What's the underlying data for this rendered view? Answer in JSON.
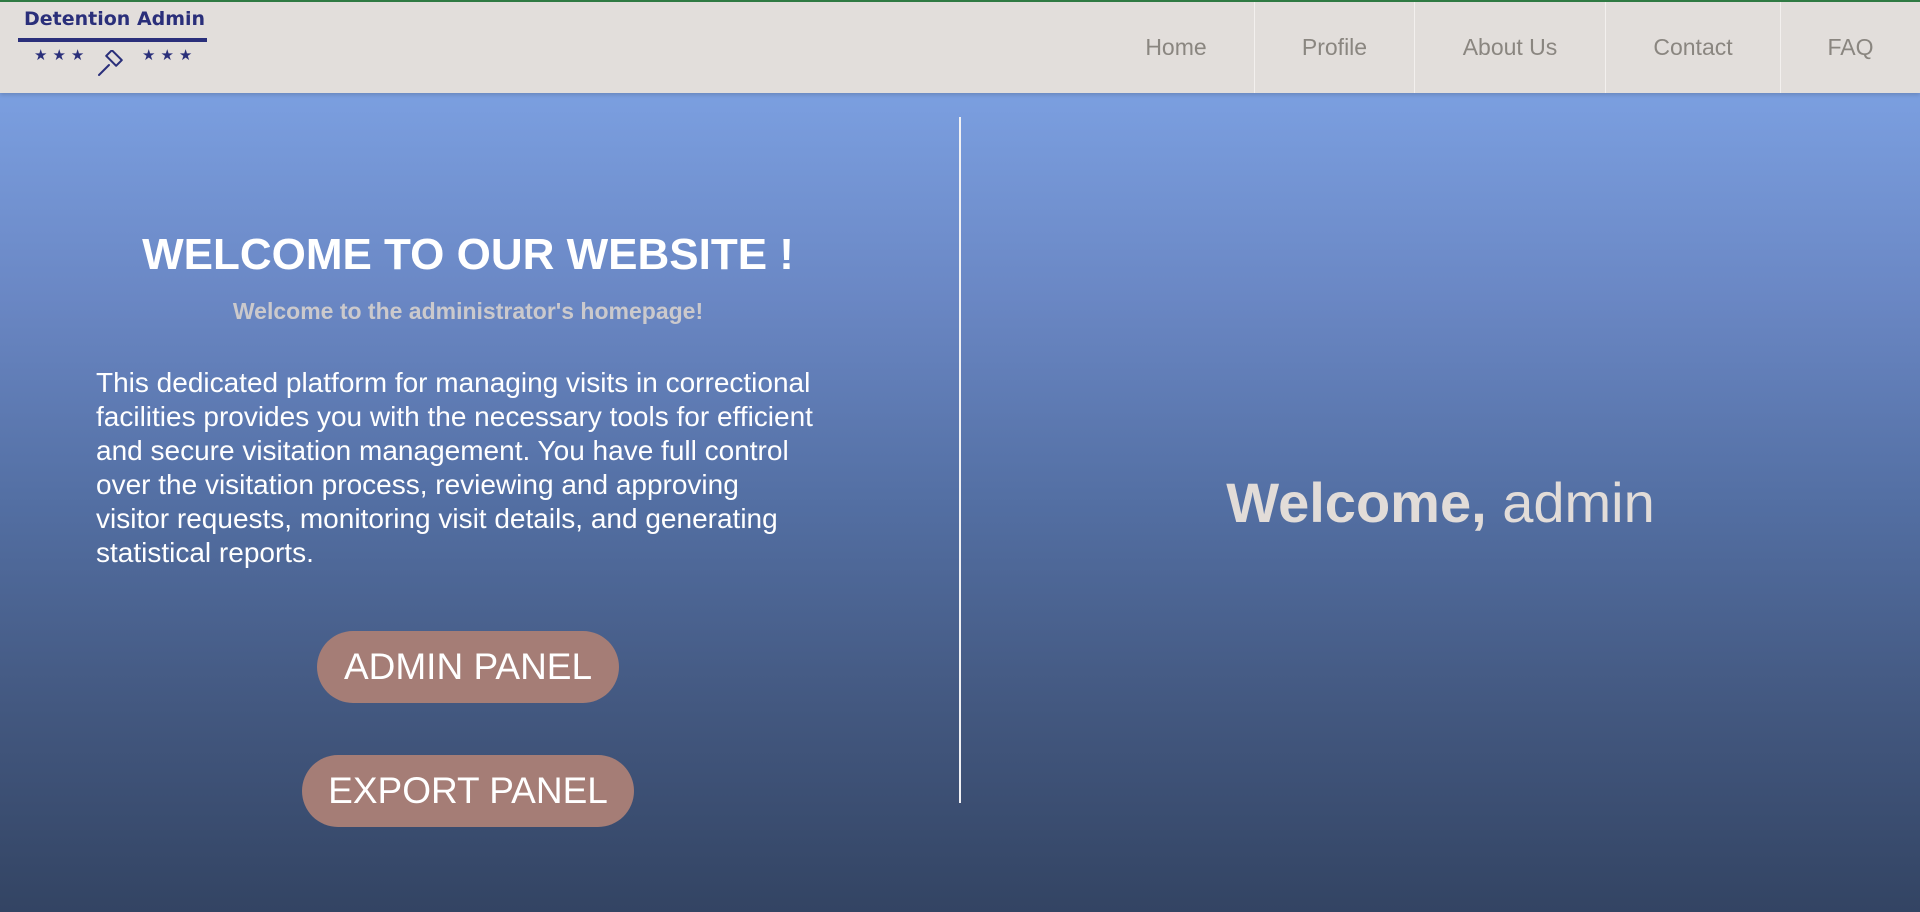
{
  "brand": {
    "name": "Detention Admin",
    "stars_left": "★★★",
    "stars_right": "★★★",
    "logo_icon": "gavel-icon",
    "logo_color": "#2a2f7a"
  },
  "nav": {
    "items": [
      {
        "label": "Home"
      },
      {
        "label": "Profile"
      },
      {
        "label": "About Us"
      },
      {
        "label": "Contact"
      },
      {
        "label": "FAQ"
      }
    ]
  },
  "hero": {
    "heading": "WELCOME TO OUR WEBSITE !",
    "subheading": "Welcome to the administrator's homepage!",
    "description": "This dedicated platform for managing visits in correctional facilities provides you with the necessary tools for efficient and secure visitation management. You have full control over the visitation process, reviewing and approving visitor requests, monitoring visit details, and generating statistical reports.",
    "admin_button": "ADMIN PANEL",
    "export_button": "EXPORT PANEL"
  },
  "greeting": {
    "prefix": "Welcome,",
    "username": "admin"
  },
  "colors": {
    "navbar_bg": "#e2dedb",
    "nav_text": "#8a8680",
    "gradient_top": "#7b9fe0",
    "gradient_bottom": "#334463",
    "button_bg": "#a57d76",
    "greeting_text": "#e2dcd8"
  }
}
